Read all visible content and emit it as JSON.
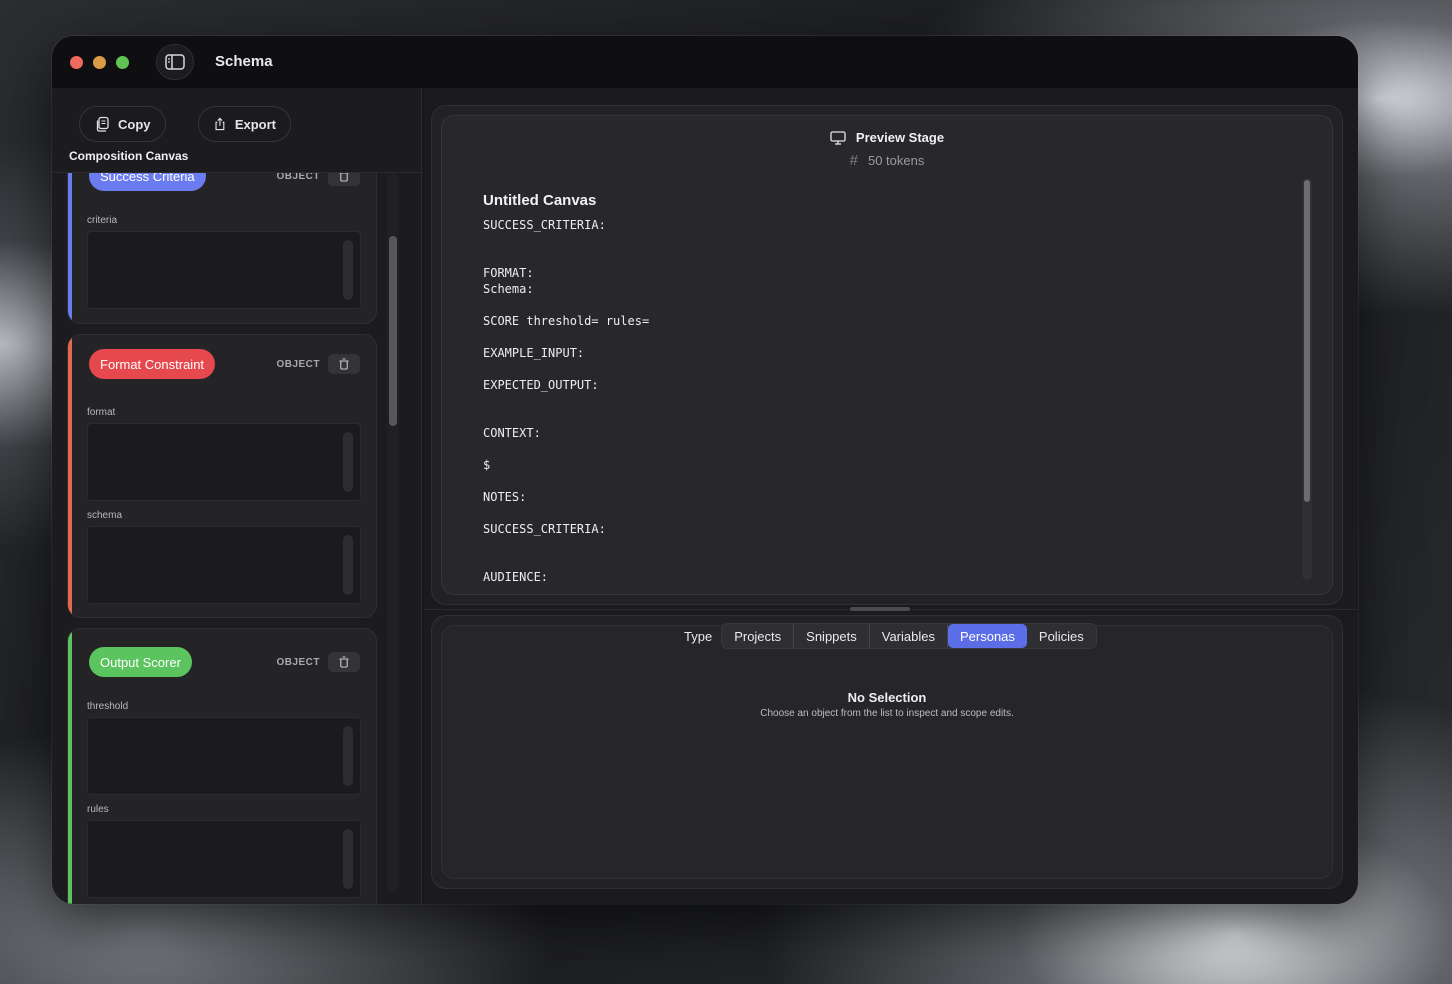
{
  "window": {
    "title": "Schema"
  },
  "toolbar": {
    "copy_label": "Copy",
    "export_label": "Export"
  },
  "canvas": {
    "label": "Composition Canvas",
    "cards": [
      {
        "name": "Success Criteria",
        "kind": "OBJECT",
        "color": "#6b7bf0",
        "fields": [
          "criteria"
        ]
      },
      {
        "name": "Format Constraint",
        "kind": "OBJECT",
        "color": "#e5484d",
        "accent": "#e0694e",
        "fields": [
          "format",
          "schema"
        ]
      },
      {
        "name": "Output Scorer",
        "kind": "OBJECT",
        "color": "#5cc45f",
        "fields": [
          "threshold",
          "rules"
        ]
      }
    ]
  },
  "preview": {
    "title": "Preview Stage",
    "tokens": "50 tokens",
    "doc_title": "Untitled Canvas",
    "lines": [
      "SUCCESS_CRITERIA:",
      "FORMAT:",
      "Schema:",
      "SCORE threshold= rules=",
      "EXAMPLE_INPUT:",
      "EXPECTED_OUTPUT:",
      "CONTEXT:",
      "$",
      "NOTES:",
      "SUCCESS_CRITERIA:",
      "AUDIENCE:"
    ]
  },
  "inspector": {
    "type_label": "Type",
    "tabs": [
      "Projects",
      "Snippets",
      "Variables",
      "Personas",
      "Policies"
    ],
    "active_tab": "Personas",
    "empty_title": "No Selection",
    "empty_subtitle": "Choose an object from the list to inspect and scope edits."
  },
  "colors": {
    "accent": "#5b6ee8",
    "traffic_red": "#ec6a5e",
    "traffic_yellow": "#d99b48",
    "traffic_green": "#5fc454"
  }
}
